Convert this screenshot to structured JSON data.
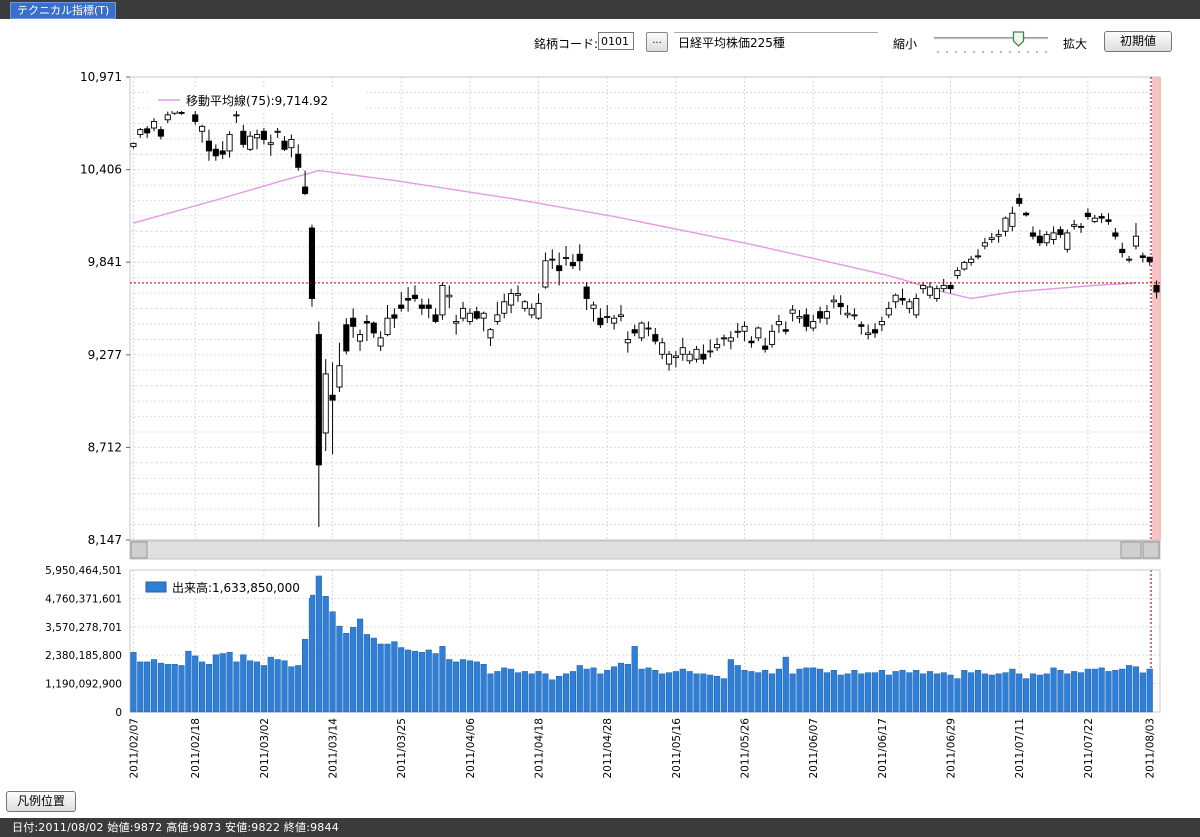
{
  "window": {
    "tab_title": "テクニカル指標(T)"
  },
  "toolbar": {
    "code_label": "銘柄コード:",
    "code_value": "0101",
    "browse_label": "...",
    "name_value": "日経平均株価225種",
    "zoom_out_label": "縮小",
    "zoom_in_label": "拡大",
    "zoom_level": 0.75,
    "reset_label": "初期値"
  },
  "legend_position_label": "凡例位置",
  "status_text": "日付:2011/08/02 始値:9872 高値:9873 安値:9822 終値:9844",
  "colors": {
    "ma": "#e49ae4",
    "volume": "#2f7fd6",
    "cursor_band": "#f6b8b8",
    "crosshair": "#b40000"
  },
  "chart_data": [
    {
      "type": "candlestick",
      "legend": "移動平均線(75):9,714.92",
      "y_ticks": [
        "10,971",
        "10,406",
        "9,841",
        "9,277",
        "8,712",
        "8,147"
      ],
      "ylim": [
        8147,
        10971
      ],
      "crosshair_y": 9714.92,
      "candles": [
        [
          10547,
          10571,
          10534,
          10566
        ],
        [
          10620,
          10660,
          10600,
          10650
        ],
        [
          10655,
          10671,
          10600,
          10630
        ],
        [
          10660,
          10720,
          10640,
          10700
        ],
        [
          10650,
          10670,
          10590,
          10610
        ],
        [
          10710,
          10760,
          10690,
          10740
        ],
        [
          10750,
          10780,
          10740,
          10770
        ],
        [
          10755,
          10785,
          10740,
          10750
        ],
        [
          10770,
          10800,
          10770,
          10800
        ],
        [
          10740,
          10771,
          10680,
          10700
        ],
        [
          10640,
          10680,
          10570,
          10670
        ],
        [
          10580,
          10650,
          10460,
          10520
        ],
        [
          10530,
          10560,
          10460,
          10490
        ],
        [
          10520,
          10580,
          10470,
          10500
        ],
        [
          10520,
          10640,
          10480,
          10620
        ],
        [
          10740,
          10780,
          10690,
          10740
        ],
        [
          10640,
          10680,
          10540,
          10560
        ],
        [
          10530,
          10640,
          10520,
          10610
        ],
        [
          10600,
          10650,
          10530,
          10620
        ],
        [
          10640,
          10660,
          10560,
          10590
        ],
        [
          10560,
          10620,
          10490,
          10570
        ],
        [
          10640,
          10660,
          10600,
          10640
        ],
        [
          10580,
          10610,
          10520,
          10530
        ],
        [
          10540,
          10620,
          10480,
          10590
        ],
        [
          10500,
          10560,
          10400,
          10420
        ],
        [
          10300,
          10400,
          10250,
          10260
        ],
        [
          10050,
          10070,
          9570,
          9620
        ],
        [
          9400,
          9480,
          8227,
          8605
        ],
        [
          8800,
          9250,
          8690,
          9160
        ],
        [
          9030,
          9230,
          8670,
          9000
        ],
        [
          9080,
          9350,
          9050,
          9210
        ],
        [
          9460,
          9500,
          9280,
          9300
        ],
        [
          9500,
          9560,
          9380,
          9450
        ],
        [
          9360,
          9430,
          9300,
          9400
        ],
        [
          9480,
          9520,
          9360,
          9470
        ],
        [
          9470,
          9480,
          9380,
          9410
        ],
        [
          9330,
          9420,
          9300,
          9380
        ],
        [
          9400,
          9580,
          9390,
          9500
        ],
        [
          9520,
          9560,
          9440,
          9500
        ],
        [
          9580,
          9660,
          9540,
          9560
        ],
        [
          9620,
          9690,
          9540,
          9610
        ],
        [
          9640,
          9700,
          9600,
          9620
        ],
        [
          9580,
          9620,
          9520,
          9560
        ],
        [
          9580,
          9620,
          9500,
          9560
        ],
        [
          9520,
          9560,
          9470,
          9480
        ],
        [
          9520,
          9720,
          9490,
          9700
        ],
        [
          9630,
          9700,
          9560,
          9640
        ],
        [
          9470,
          9520,
          9400,
          9480
        ],
        [
          9500,
          9600,
          9480,
          9560
        ],
        [
          9480,
          9560,
          9460,
          9530
        ],
        [
          9540,
          9570,
          9490,
          9500
        ],
        [
          9500,
          9540,
          9420,
          9530
        ],
        [
          9380,
          9440,
          9330,
          9430
        ],
        [
          9480,
          9600,
          9460,
          9520
        ],
        [
          9530,
          9650,
          9500,
          9600
        ],
        [
          9580,
          9680,
          9530,
          9650
        ],
        [
          9640,
          9700,
          9600,
          9650
        ],
        [
          9560,
          9610,
          9540,
          9600
        ],
        [
          9520,
          9590,
          9500,
          9560
        ],
        [
          9500,
          9650,
          9490,
          9590
        ],
        [
          9690,
          9900,
          9680,
          9850
        ],
        [
          9860,
          9920,
          9800,
          9860
        ],
        [
          9820,
          9900,
          9700,
          9790
        ],
        [
          9870,
          9940,
          9820,
          9870
        ],
        [
          9840,
          9890,
          9800,
          9820
        ],
        [
          9890,
          9950,
          9790,
          9850
        ],
        [
          9690,
          9720,
          9550,
          9620
        ],
        [
          9560,
          9600,
          9480,
          9580
        ],
        [
          9500,
          9560,
          9440,
          9460
        ],
        [
          9510,
          9580,
          9470,
          9510
        ],
        [
          9470,
          9520,
          9430,
          9500
        ],
        [
          9510,
          9580,
          9480,
          9520
        ],
        [
          9350,
          9420,
          9290,
          9370
        ],
        [
          9430,
          9460,
          9390,
          9410
        ],
        [
          9380,
          9480,
          9360,
          9470
        ],
        [
          9440,
          9480,
          9390,
          9440
        ],
        [
          9400,
          9440,
          9340,
          9360
        ],
        [
          9280,
          9380,
          9250,
          9350
        ],
        [
          9220,
          9300,
          9180,
          9280
        ],
        [
          9260,
          9300,
          9200,
          9270
        ],
        [
          9280,
          9380,
          9240,
          9320
        ],
        [
          9240,
          9300,
          9220,
          9280
        ],
        [
          9250,
          9330,
          9230,
          9310
        ],
        [
          9280,
          9340,
          9220,
          9250
        ],
        [
          9300,
          9370,
          9260,
          9300
        ],
        [
          9320,
          9380,
          9300,
          9340
        ],
        [
          9380,
          9400,
          9330,
          9380
        ],
        [
          9360,
          9420,
          9310,
          9380
        ],
        [
          9420,
          9470,
          9380,
          9420
        ],
        [
          9420,
          9480,
          9360,
          9450
        ],
        [
          9360,
          9390,
          9320,
          9350
        ],
        [
          9380,
          9450,
          9360,
          9440
        ],
        [
          9330,
          9380,
          9290,
          9310
        ],
        [
          9340,
          9460,
          9320,
          9420
        ],
        [
          9460,
          9520,
          9410,
          9480
        ],
        [
          9430,
          9480,
          9400,
          9420
        ],
        [
          9530,
          9580,
          9480,
          9550
        ],
        [
          9500,
          9550,
          9470,
          9510
        ],
        [
          9520,
          9560,
          9420,
          9450
        ],
        [
          9440,
          9520,
          9420,
          9480
        ],
        [
          9540,
          9570,
          9470,
          9500
        ],
        [
          9500,
          9580,
          9460,
          9540
        ],
        [
          9600,
          9640,
          9560,
          9610
        ],
        [
          9590,
          9640,
          9520,
          9570
        ],
        [
          9520,
          9580,
          9500,
          9530
        ],
        [
          9520,
          9560,
          9490,
          9520
        ],
        [
          9460,
          9480,
          9400,
          9450
        ],
        [
          9400,
          9460,
          9370,
          9410
        ],
        [
          9430,
          9470,
          9380,
          9410
        ],
        [
          9460,
          9510,
          9420,
          9480
        ],
        [
          9520,
          9600,
          9500,
          9560
        ],
        [
          9600,
          9650,
          9560,
          9640
        ],
        [
          9620,
          9680,
          9580,
          9610
        ],
        [
          9560,
          9620,
          9530,
          9600
        ],
        [
          9520,
          9650,
          9500,
          9620
        ],
        [
          9680,
          9720,
          9650,
          9700
        ],
        [
          9640,
          9720,
          9620,
          9690
        ],
        [
          9620,
          9700,
          9600,
          9680
        ],
        [
          9680,
          9740,
          9660,
          9700
        ],
        [
          9700,
          9720,
          9650,
          9680
        ],
        [
          9760,
          9810,
          9740,
          9790
        ],
        [
          9800,
          9850,
          9790,
          9840
        ],
        [
          9840,
          9880,
          9820,
          9860
        ],
        [
          9880,
          9920,
          9860,
          9880
        ],
        [
          9940,
          9990,
          9920,
          9960
        ],
        [
          9980,
          10020,
          9960,
          9990
        ],
        [
          10000,
          10040,
          9960,
          10010
        ],
        [
          10030,
          10120,
          10000,
          10110
        ],
        [
          10060,
          10180,
          10030,
          10140
        ],
        [
          10230,
          10260,
          10180,
          10200
        ],
        [
          10140,
          10150,
          10120,
          10130
        ],
        [
          10020,
          10060,
          9980,
          10000
        ],
        [
          10000,
          10040,
          9940,
          9960
        ],
        [
          9960,
          10030,
          9940,
          10010
        ],
        [
          9980,
          10060,
          9950,
          10020
        ],
        [
          10040,
          10060,
          9990,
          10010
        ],
        [
          9920,
          10040,
          9900,
          10020
        ],
        [
          10060,
          10100,
          10040,
          10070
        ],
        [
          10060,
          10080,
          10020,
          10060
        ],
        [
          10140,
          10170,
          10100,
          10120
        ],
        [
          10090,
          10130,
          10080,
          10110
        ],
        [
          10120,
          10140,
          10080,
          10110
        ],
        [
          10100,
          10140,
          10070,
          10090
        ],
        [
          10020,
          10050,
          9980,
          10000
        ],
        [
          9920,
          9960,
          9870,
          9900
        ],
        [
          9860,
          9880,
          9840,
          9860
        ],
        [
          9940,
          10080,
          9920,
          10000
        ],
        [
          9880,
          9900,
          9840,
          9870
        ],
        [
          9872,
          9873,
          9822,
          9844
        ],
        [
          9700,
          9730,
          9620,
          9660
        ]
      ],
      "moving_average": [
        [
          0,
          10080
        ],
        [
          12,
          10220
        ],
        [
          21,
          10330
        ],
        [
          27,
          10400
        ],
        [
          38,
          10340
        ],
        [
          55,
          10230
        ],
        [
          70,
          10120
        ],
        [
          90,
          9950
        ],
        [
          110,
          9760
        ],
        [
          118,
          9660
        ],
        [
          122,
          9620
        ],
        [
          128,
          9660
        ],
        [
          140,
          9700
        ],
        [
          146,
          9714.92
        ]
      ]
    },
    {
      "type": "bar",
      "legend": "出来高:1,633,850,000",
      "y_ticks": [
        "5,950,464,501",
        "4,760,371,601",
        "3,570,278,701",
        "2,380,185,800",
        "1,190,092,900",
        "0"
      ],
      "ylim": [
        0,
        5950464501
      ],
      "x_ticks": [
        "2011/02/07",
        "2011/02/18",
        "2011/03/02",
        "2011/03/14",
        "2011/03/25",
        "2011/04/06",
        "2011/04/18",
        "2011/04/28",
        "2011/05/16",
        "2011/05/26",
        "2011/06/07",
        "2011/06/17",
        "2011/06/29",
        "2011/07/11",
        "2011/07/22",
        "2011/08/03"
      ],
      "x_tick_index": [
        0,
        9,
        19,
        29,
        39,
        49,
        59,
        69,
        79,
        89,
        99,
        109,
        119,
        129,
        139,
        148
      ],
      "values": [
        2.5,
        2.1,
        2.1,
        2.2,
        2.05,
        2.0,
        2.0,
        1.95,
        2.55,
        2.35,
        2.1,
        2.0,
        2.4,
        2.45,
        2.5,
        2.1,
        2.4,
        2.15,
        2.1,
        1.95,
        2.3,
        2.2,
        2.15,
        1.9,
        1.95,
        3.05,
        4.9,
        5.7,
        4.85,
        4.2,
        3.6,
        3.3,
        3.55,
        3.9,
        3.25,
        3.1,
        2.85,
        2.85,
        2.95,
        2.7,
        2.6,
        2.55,
        2.5,
        2.6,
        2.45,
        2.75,
        2.2,
        2.1,
        2.2,
        2.15,
        2.1,
        2.0,
        1.6,
        1.7,
        1.85,
        1.8,
        1.65,
        1.7,
        1.6,
        1.7,
        1.6,
        1.35,
        1.5,
        1.6,
        1.7,
        1.95,
        1.8,
        1.85,
        1.6,
        1.75,
        1.9,
        2.05,
        2.0,
        2.75,
        1.8,
        1.85,
        1.75,
        1.6,
        1.65,
        1.7,
        1.8,
        1.7,
        1.6,
        1.6,
        1.55,
        1.5,
        1.4,
        2.2,
        1.95,
        1.75,
        1.7,
        1.65,
        1.75,
        1.6,
        1.8,
        2.3,
        1.6,
        1.8,
        1.85,
        1.85,
        1.8,
        1.65,
        1.75,
        1.55,
        1.6,
        1.75,
        1.6,
        1.65,
        1.65,
        1.75,
        1.55,
        1.7,
        1.75,
        1.65,
        1.75,
        1.6,
        1.7,
        1.6,
        1.65,
        1.55,
        1.4,
        1.75,
        1.65,
        1.75,
        1.6,
        1.55,
        1.6,
        1.65,
        1.8,
        1.6,
        1.4,
        1.6,
        1.55,
        1.6,
        1.85,
        1.75,
        1.6,
        1.7,
        1.65,
        1.8,
        1.8,
        1.85,
        1.7,
        1.75,
        1.8,
        1.95,
        1.9,
        1.64,
        1.8
      ],
      "value_unit": "1e9"
    }
  ]
}
